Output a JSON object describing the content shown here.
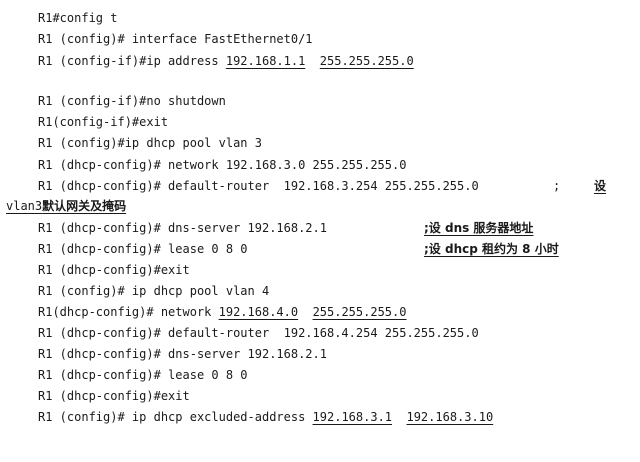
{
  "document": {
    "lines": {
      "l1": {
        "text": "R1#config t"
      },
      "l2": {
        "text": "R1 (config)# interface FastEthernet0/1"
      },
      "l3": {
        "prefix": "R1 (config-if)#ip address ",
        "ip": "192.168.1.1",
        "mask": "255.255.255.0"
      },
      "l4": {
        "text": "R1 (config-if)#no shutdown"
      },
      "l5": {
        "text": "R1(config-if)#exit"
      },
      "l6": {
        "text": "R1 (config)#ip dhcp pool vlan 3"
      },
      "l7": {
        "text": "R1 (dhcp-config)# network 192.168.3.0 255.255.255.0"
      },
      "l8": {
        "text": "R1 (dhcp-config)# default-router  192.168.3.254 255.255.255.0",
        "semicolon": ";",
        "comment_start": "设"
      },
      "l9": {
        "prefix": "vlan3",
        "comment": "默认网关及掩码"
      },
      "l10": {
        "text": "R1 (dhcp-config)# dns-server 192.168.2.1",
        "comment": ";设 dns 服务器地址"
      },
      "l11": {
        "text": "R1 (dhcp-config)# lease 0 8 0",
        "comment": ";设 dhcp 租约为 8 小时"
      },
      "l12": {
        "text": "R1 (dhcp-config)#exit"
      },
      "l13": {
        "text": "R1 (config)# ip dhcp pool vlan 4"
      },
      "l14": {
        "prefix": "R1(dhcp-config)# network ",
        "ip": "192.168.4.0",
        "mask": "255.255.255.0"
      },
      "l15": {
        "text": "R1 (dhcp-config)# default-router  192.168.4.254 255.255.255.0"
      },
      "l16": {
        "text": "R1 (dhcp-config)# dns-server 192.168.2.1"
      },
      "l17": {
        "text": "R1 (dhcp-config)# lease 0 8 0"
      },
      "l18": {
        "text": "R1 (dhcp-config)#exit"
      },
      "l19": {
        "prefix": "R1 (config)# ip dhcp excluded-address ",
        "ip_start": "192.168.3.1",
        "ip_end": "192.168.3.10"
      }
    }
  }
}
